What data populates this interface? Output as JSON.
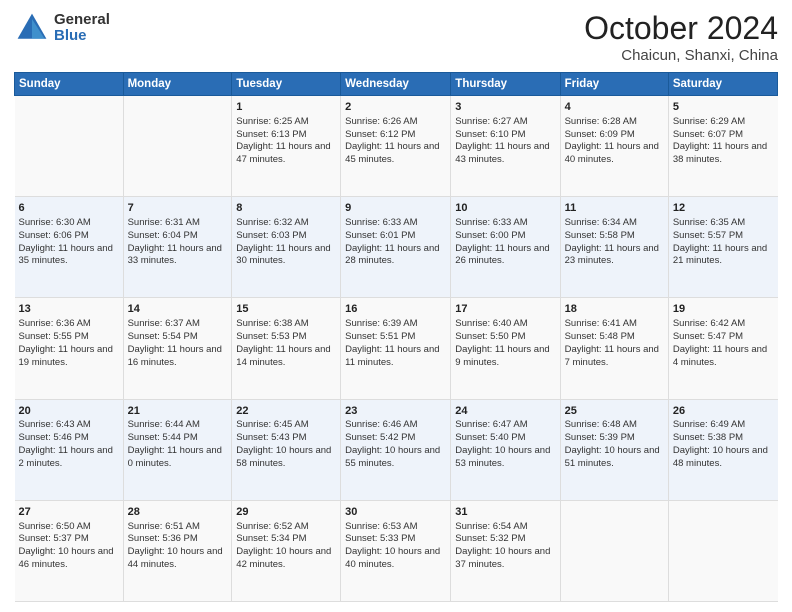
{
  "logo": {
    "general": "General",
    "blue": "Blue"
  },
  "title": {
    "month": "October 2024",
    "location": "Chaicun, Shanxi, China"
  },
  "days_of_week": [
    "Sunday",
    "Monday",
    "Tuesday",
    "Wednesday",
    "Thursday",
    "Friday",
    "Saturday"
  ],
  "weeks": [
    [
      {
        "day": "",
        "info": ""
      },
      {
        "day": "",
        "info": ""
      },
      {
        "day": "1",
        "info": "Sunrise: 6:25 AM\nSunset: 6:13 PM\nDaylight: 11 hours and 47 minutes."
      },
      {
        "day": "2",
        "info": "Sunrise: 6:26 AM\nSunset: 6:12 PM\nDaylight: 11 hours and 45 minutes."
      },
      {
        "day": "3",
        "info": "Sunrise: 6:27 AM\nSunset: 6:10 PM\nDaylight: 11 hours and 43 minutes."
      },
      {
        "day": "4",
        "info": "Sunrise: 6:28 AM\nSunset: 6:09 PM\nDaylight: 11 hours and 40 minutes."
      },
      {
        "day": "5",
        "info": "Sunrise: 6:29 AM\nSunset: 6:07 PM\nDaylight: 11 hours and 38 minutes."
      }
    ],
    [
      {
        "day": "6",
        "info": "Sunrise: 6:30 AM\nSunset: 6:06 PM\nDaylight: 11 hours and 35 minutes."
      },
      {
        "day": "7",
        "info": "Sunrise: 6:31 AM\nSunset: 6:04 PM\nDaylight: 11 hours and 33 minutes."
      },
      {
        "day": "8",
        "info": "Sunrise: 6:32 AM\nSunset: 6:03 PM\nDaylight: 11 hours and 30 minutes."
      },
      {
        "day": "9",
        "info": "Sunrise: 6:33 AM\nSunset: 6:01 PM\nDaylight: 11 hours and 28 minutes."
      },
      {
        "day": "10",
        "info": "Sunrise: 6:33 AM\nSunset: 6:00 PM\nDaylight: 11 hours and 26 minutes."
      },
      {
        "day": "11",
        "info": "Sunrise: 6:34 AM\nSunset: 5:58 PM\nDaylight: 11 hours and 23 minutes."
      },
      {
        "day": "12",
        "info": "Sunrise: 6:35 AM\nSunset: 5:57 PM\nDaylight: 11 hours and 21 minutes."
      }
    ],
    [
      {
        "day": "13",
        "info": "Sunrise: 6:36 AM\nSunset: 5:55 PM\nDaylight: 11 hours and 19 minutes."
      },
      {
        "day": "14",
        "info": "Sunrise: 6:37 AM\nSunset: 5:54 PM\nDaylight: 11 hours and 16 minutes."
      },
      {
        "day": "15",
        "info": "Sunrise: 6:38 AM\nSunset: 5:53 PM\nDaylight: 11 hours and 14 minutes."
      },
      {
        "day": "16",
        "info": "Sunrise: 6:39 AM\nSunset: 5:51 PM\nDaylight: 11 hours and 11 minutes."
      },
      {
        "day": "17",
        "info": "Sunrise: 6:40 AM\nSunset: 5:50 PM\nDaylight: 11 hours and 9 minutes."
      },
      {
        "day": "18",
        "info": "Sunrise: 6:41 AM\nSunset: 5:48 PM\nDaylight: 11 hours and 7 minutes."
      },
      {
        "day": "19",
        "info": "Sunrise: 6:42 AM\nSunset: 5:47 PM\nDaylight: 11 hours and 4 minutes."
      }
    ],
    [
      {
        "day": "20",
        "info": "Sunrise: 6:43 AM\nSunset: 5:46 PM\nDaylight: 11 hours and 2 minutes."
      },
      {
        "day": "21",
        "info": "Sunrise: 6:44 AM\nSunset: 5:44 PM\nDaylight: 11 hours and 0 minutes."
      },
      {
        "day": "22",
        "info": "Sunrise: 6:45 AM\nSunset: 5:43 PM\nDaylight: 10 hours and 58 minutes."
      },
      {
        "day": "23",
        "info": "Sunrise: 6:46 AM\nSunset: 5:42 PM\nDaylight: 10 hours and 55 minutes."
      },
      {
        "day": "24",
        "info": "Sunrise: 6:47 AM\nSunset: 5:40 PM\nDaylight: 10 hours and 53 minutes."
      },
      {
        "day": "25",
        "info": "Sunrise: 6:48 AM\nSunset: 5:39 PM\nDaylight: 10 hours and 51 minutes."
      },
      {
        "day": "26",
        "info": "Sunrise: 6:49 AM\nSunset: 5:38 PM\nDaylight: 10 hours and 48 minutes."
      }
    ],
    [
      {
        "day": "27",
        "info": "Sunrise: 6:50 AM\nSunset: 5:37 PM\nDaylight: 10 hours and 46 minutes."
      },
      {
        "day": "28",
        "info": "Sunrise: 6:51 AM\nSunset: 5:36 PM\nDaylight: 10 hours and 44 minutes."
      },
      {
        "day": "29",
        "info": "Sunrise: 6:52 AM\nSunset: 5:34 PM\nDaylight: 10 hours and 42 minutes."
      },
      {
        "day": "30",
        "info": "Sunrise: 6:53 AM\nSunset: 5:33 PM\nDaylight: 10 hours and 40 minutes."
      },
      {
        "day": "31",
        "info": "Sunrise: 6:54 AM\nSunset: 5:32 PM\nDaylight: 10 hours and 37 minutes."
      },
      {
        "day": "",
        "info": ""
      },
      {
        "day": "",
        "info": ""
      }
    ]
  ]
}
